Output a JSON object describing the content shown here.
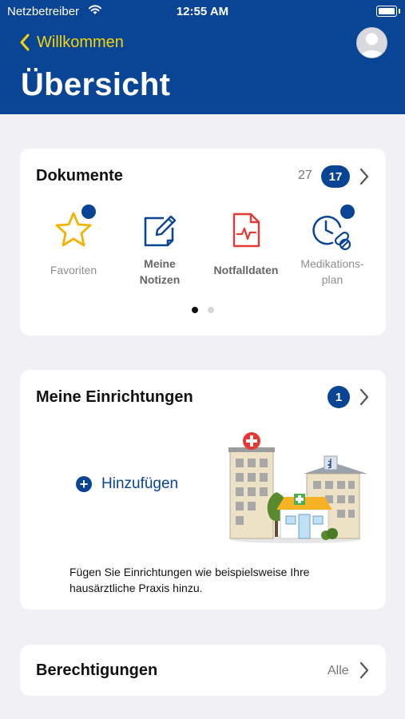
{
  "status_bar": {
    "carrier": "Netzbetreiber",
    "time": "12:55 AM"
  },
  "nav": {
    "back_label": "Willkommen",
    "title": "Übersicht"
  },
  "documents": {
    "title": "Dokumente",
    "count": "27",
    "badge": "17",
    "items": [
      {
        "label": "Favoriten",
        "icon": "star-icon"
      },
      {
        "label": "Meine\nNotizen",
        "icon": "note-edit-icon"
      },
      {
        "label": "Notfalldaten",
        "icon": "emergency-document-icon"
      },
      {
        "label": "Medikations-\nplan",
        "icon": "medication-clock-icon"
      }
    ],
    "pages": 2,
    "active_page": 1
  },
  "facilities": {
    "title": "Meine Einrichtungen",
    "badge": "1",
    "add_label": "Hinzufügen",
    "hint": "Fügen Sie Einrichtungen wie beispielsweise Ihre hausärztliche Praxis hinzu."
  },
  "permissions": {
    "title": "Berechtigungen",
    "filter": "Alle"
  },
  "colors": {
    "primary": "#0a4494",
    "accent": "#f5d40a",
    "star": "#f4b300",
    "emergency": "#e53935",
    "background": "#f0f0f5"
  }
}
